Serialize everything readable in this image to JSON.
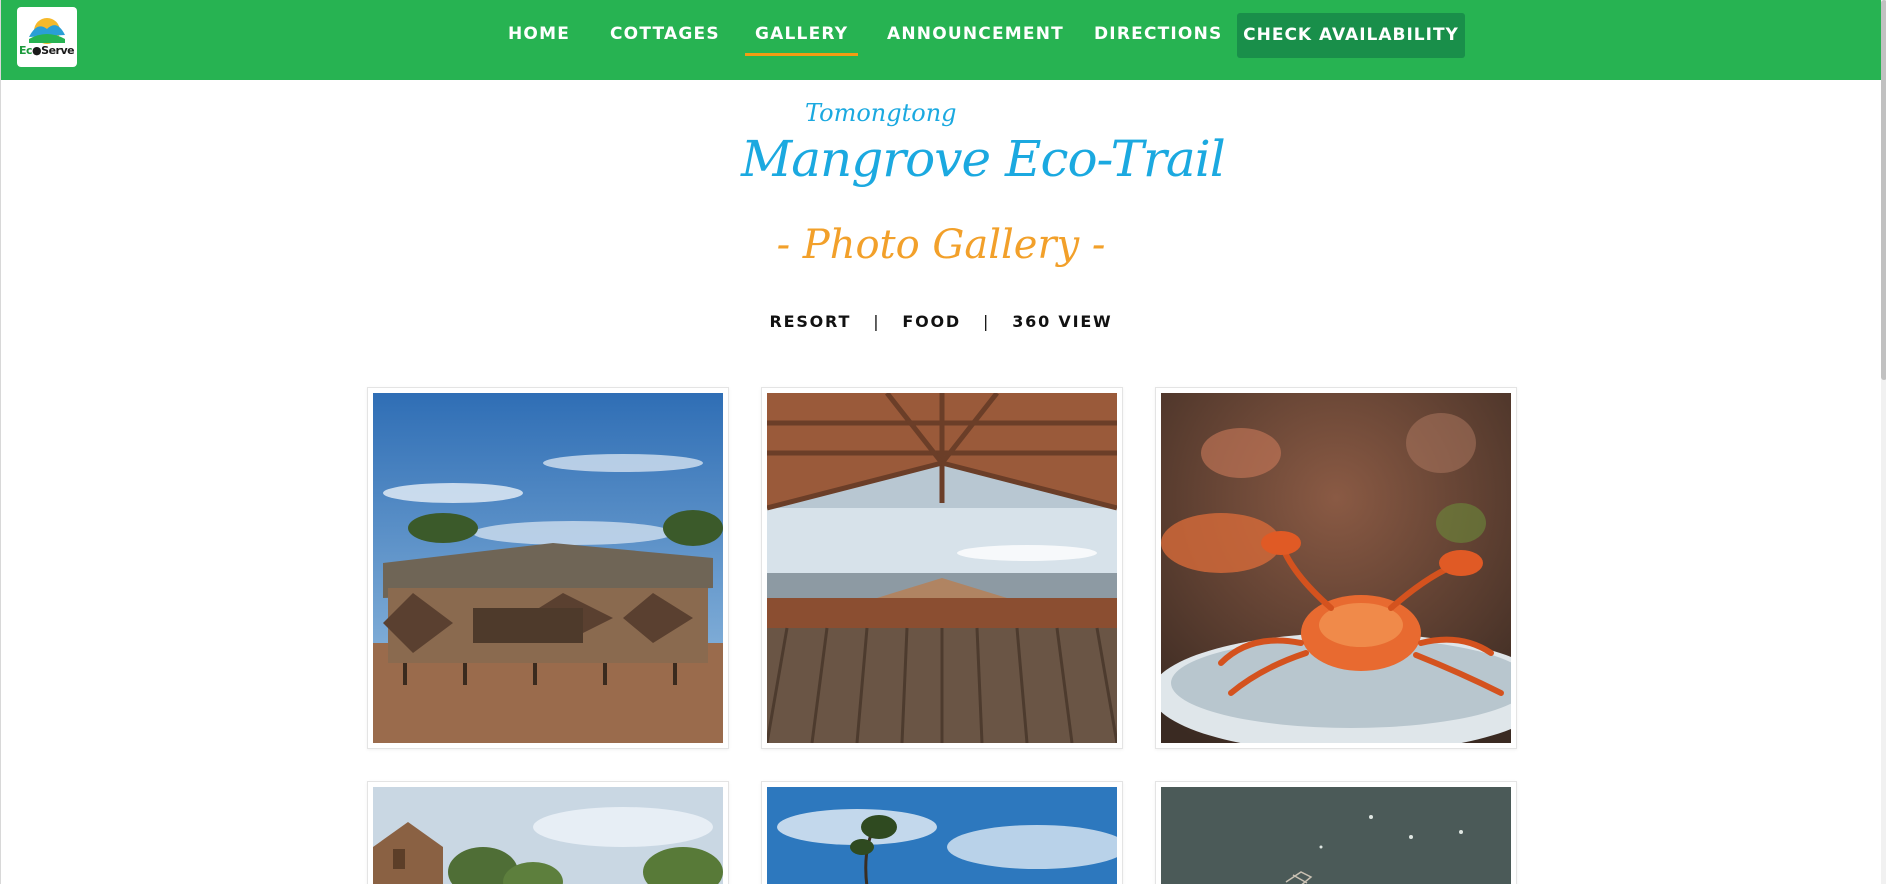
{
  "navbar": {
    "logo_text_1": "Ec",
    "logo_text_2": "Serve",
    "items": [
      {
        "label": "HOME"
      },
      {
        "label": "COTTAGES"
      },
      {
        "label": "GALLERY"
      },
      {
        "label": "ANNOUNCEMENT"
      },
      {
        "label": "DIRECTIONS"
      }
    ],
    "active_item": "GALLERY",
    "cta_label": "CHECK AVAILABILITY"
  },
  "hero": {
    "pre_title": "Tomongtong",
    "title": "Mangrove Eco-Trail",
    "subtitle": "- Photo Gallery -"
  },
  "filters": {
    "items": [
      {
        "label": "RESORT"
      },
      {
        "label": "FOOD"
      },
      {
        "label": "360 VIEW"
      }
    ],
    "separator": "|"
  },
  "gallery": {
    "images": [
      {
        "subject": "bamboo-cottages-photo"
      },
      {
        "subject": "bamboo-deck-seaview-photo"
      },
      {
        "subject": "crab-dish-photo"
      },
      {
        "subject": "cottage-trees-photo"
      },
      {
        "subject": "sky-tree-photo"
      },
      {
        "subject": "water-aerial-photo"
      }
    ]
  },
  "colors": {
    "nav_green": "#27b352",
    "cta_green": "#198f4a",
    "active_underline": "#f39c12",
    "title_blue": "#1ba9e0",
    "subtitle_orange": "#f2a02a"
  }
}
